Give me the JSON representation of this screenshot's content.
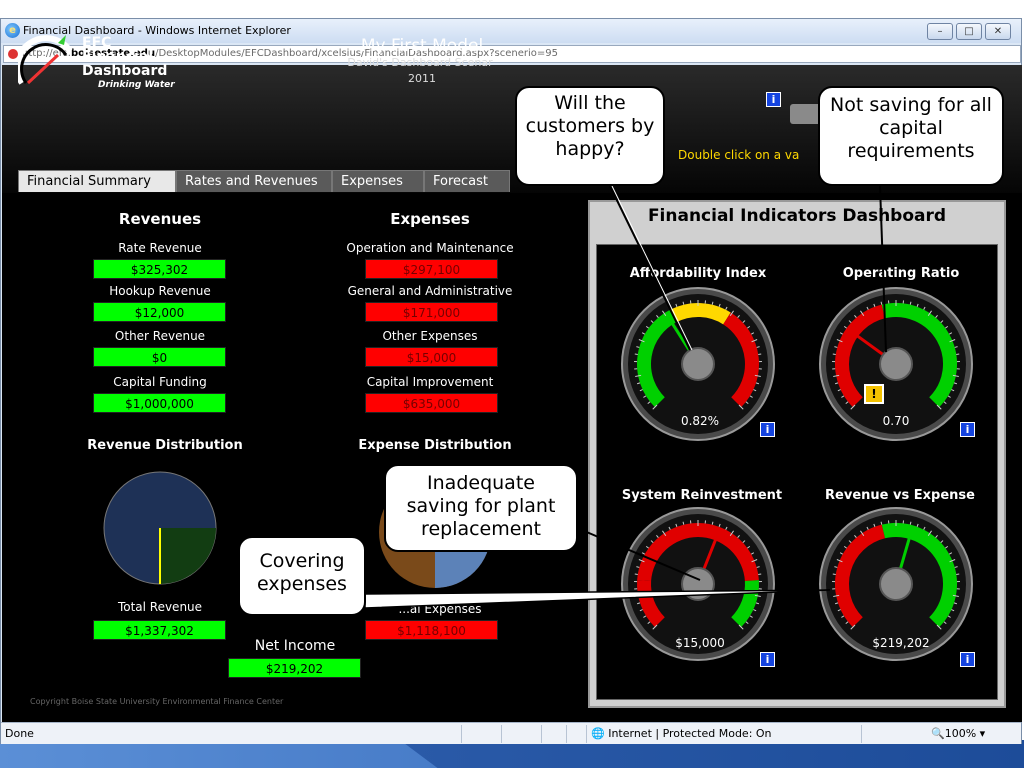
{
  "window": {
    "title": "Financial Dashboard - Windows Internet Explorer",
    "url_prefix": "http://efc.",
    "url_domain": "boisestate.edu",
    "url_rest": "/DesktopModules/EFCDashboard/xcelsius/FinancialDashboard.aspx?scenerio=95",
    "buttons": {
      "minimize": "–",
      "maximize": "□",
      "close": "✕"
    }
  },
  "status": {
    "left": "Done",
    "zone": "Internet | Protected Mode: On",
    "zoom": "100%"
  },
  "logo": {
    "line1": "EFC",
    "line2": "Financial",
    "line3": "Dashboard",
    "line4": "Drinking Water"
  },
  "model": {
    "title": "My First Model",
    "subtitle": "David's Dashboard Scenar",
    "year": "2011"
  },
  "hint": "Double click on a va",
  "tabs": [
    "Financial Summary",
    "Rates and Revenues",
    "Expenses",
    "Forecast"
  ],
  "revenues": {
    "heading": "Revenues",
    "items": [
      {
        "label": "Rate Revenue",
        "value": "$325,302"
      },
      {
        "label": "Hookup Revenue",
        "value": "$12,000"
      },
      {
        "label": "Other Revenue",
        "value": "$0"
      },
      {
        "label": "Capital Funding",
        "value": "$1,000,000"
      }
    ],
    "dist_heading": "Revenue Distribution",
    "total_label": "Total Revenue",
    "total_value": "$1,337,302"
  },
  "expenses": {
    "heading": "Expenses",
    "items": [
      {
        "label": "Operation and Maintenance",
        "value": "$297,100"
      },
      {
        "label": "General and Administrative",
        "value": "$171,000"
      },
      {
        "label": "Other Expenses",
        "value": "$15,000"
      },
      {
        "label": "Capital Improvement",
        "value": "$635,000"
      }
    ],
    "dist_heading": "Expense Distribution",
    "total_label": "...al Expenses",
    "total_value": "$1,118,100"
  },
  "net_income": {
    "label": "Net Income",
    "value": "$219,202"
  },
  "copyright": "Copyright Boise State University Environmental Finance Center",
  "panel": {
    "title": "Financial Indicators Dashboard",
    "gauges": [
      {
        "title": "Affordability Index",
        "value": "0.82%",
        "needle_fraction": 0.38
      },
      {
        "title": "Operating Ratio",
        "value": "0.70",
        "needle_fraction": 0.3
      },
      {
        "title": "System Reinvestment",
        "value": "$15,000",
        "needle_fraction": 0.58
      },
      {
        "title": "Revenue vs Expense",
        "value": "$219,202",
        "needle_fraction": 0.56
      }
    ],
    "info_label": "i",
    "warn_label": "!"
  },
  "callouts": {
    "happy": "Will the customers by happy?",
    "capital": "Not saving for all capital requirements",
    "plant": "Inadequate saving for plant replacement",
    "covering": "Covering expenses"
  },
  "colors": {
    "green": "#00ff00",
    "red": "#ff0000",
    "yellow": "#ffd800",
    "gauge_red": "#e00000",
    "gauge_green": "#00d000"
  }
}
